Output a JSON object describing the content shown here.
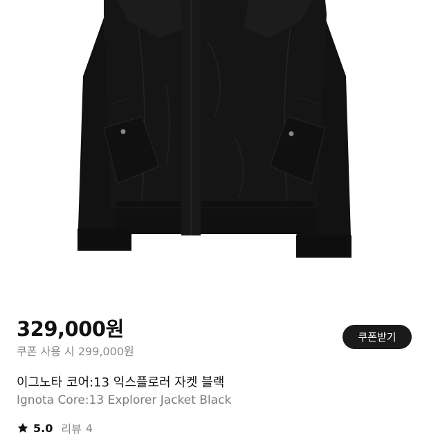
{
  "product": {
    "image_alt": "black jacket",
    "price": "329,000원",
    "coupon_price_text": "쿠폰 사용 시 299,000원",
    "coupon_button_label": "쿠폰받기",
    "name_ko": "이그노타 코어:13 익스플로러 자켓 블랙",
    "name_en": "Ignota Core:13 Explorer Jacket Black",
    "rating": "5.0",
    "review_label": "리뷰",
    "review_count": "4"
  },
  "icons": {
    "rating_star": "star-icon"
  },
  "colors": {
    "button_bg": "#1a1a1a",
    "price_text": "#111111",
    "sub_text": "#8a8a8a",
    "jacket": "#141414"
  }
}
